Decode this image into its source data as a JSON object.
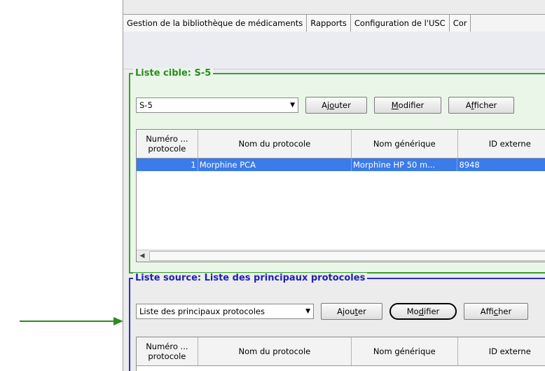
{
  "tabs": [
    {
      "label": "Gestion de la bibliothèque de médicaments"
    },
    {
      "label": "Rapports"
    },
    {
      "label": "Configuration de l'USC"
    },
    {
      "label": "Cor"
    }
  ],
  "target_panel": {
    "legend": "Liste cible: S-5",
    "select_value": "S-5",
    "buttons": {
      "add": {
        "pre": "Aj",
        "key": "o",
        "post": "uter"
      },
      "edit": {
        "pre": "",
        "key": "M",
        "post": "odifier"
      },
      "view": {
        "pre": "A",
        "key": "f",
        "post": "ficher"
      }
    },
    "columns": [
      "Numéro ...\nprotocole",
      "Nom du protocole",
      "Nom générique",
      "ID externe"
    ],
    "rows": [
      {
        "num": "1",
        "name": "Morphine PCA",
        "generic": "Morphine HP  50 m...",
        "external_id": "8948"
      }
    ]
  },
  "source_panel": {
    "legend": "Liste source: Liste des principaux protocoles",
    "select_value": "Liste des principaux protocoles",
    "buttons": {
      "add": {
        "pre": "Ajou",
        "key": "t",
        "post": "er"
      },
      "edit": {
        "pre": "Mo",
        "key": "d",
        "post": "ifier"
      },
      "view": {
        "pre": "Affi",
        "key": "c",
        "post": "her"
      }
    },
    "columns": [
      "Numéro ...\nprotocole",
      "Nom du protocole",
      "Nom générique",
      "ID externe"
    ]
  },
  "icons": {
    "dropdown": "chevron-down-icon",
    "scroll_left": "arrow-left-icon",
    "pointer": "green-arrow"
  },
  "colors": {
    "target_border": "#33a02c",
    "source_border": "#2c2cc8",
    "selection": "#3b7bea",
    "pointer": "#2e8b22"
  }
}
